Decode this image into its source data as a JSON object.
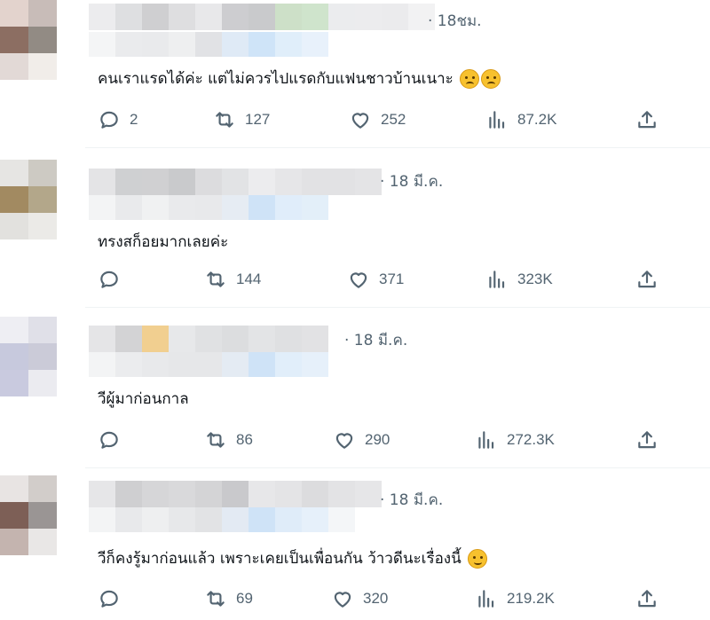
{
  "tweets": [
    {
      "time": "· 18ชม.",
      "text": "คนเราแรดได้ค่ะ แต่ไม่ควรไปแรดกับแฟนชาวบ้านเนาะ",
      "emojis": [
        "frowning-face",
        "frowning-face"
      ],
      "replies": "2",
      "retweets": "127",
      "likes": "252",
      "views": "87.2K"
    },
    {
      "time": "· 18 มี.ค.",
      "text": "ทรงสก็อยมากเลยค่ะ",
      "emojis": [],
      "replies": "",
      "retweets": "144",
      "likes": "371",
      "views": "323K"
    },
    {
      "time": "· 18 มี.ค.",
      "text": "วีผู้มาก่อนกาล",
      "emojis": [],
      "replies": "",
      "retweets": "86",
      "likes": "290",
      "views": "272.3K"
    },
    {
      "time": "· 18 มี.ค.",
      "text": "วีก็คงรู้มาก่อนแล้ว เพราะเคยเป็นเพื่อนกัน ว้าวดีนะเรื่องนี้",
      "emojis": [
        "smirking-face"
      ],
      "replies": "",
      "retweets": "69",
      "likes": "320",
      "views": "219.2K"
    }
  ],
  "icons": {
    "reply": "reply-bubble-icon",
    "retweet": "retweet-arrows-icon",
    "like": "heart-icon",
    "views": "analytics-bars-icon",
    "share": "share-upload-icon"
  },
  "colors": {
    "text": "#0f1419",
    "muted": "#536471",
    "divider": "#eff3f4"
  }
}
